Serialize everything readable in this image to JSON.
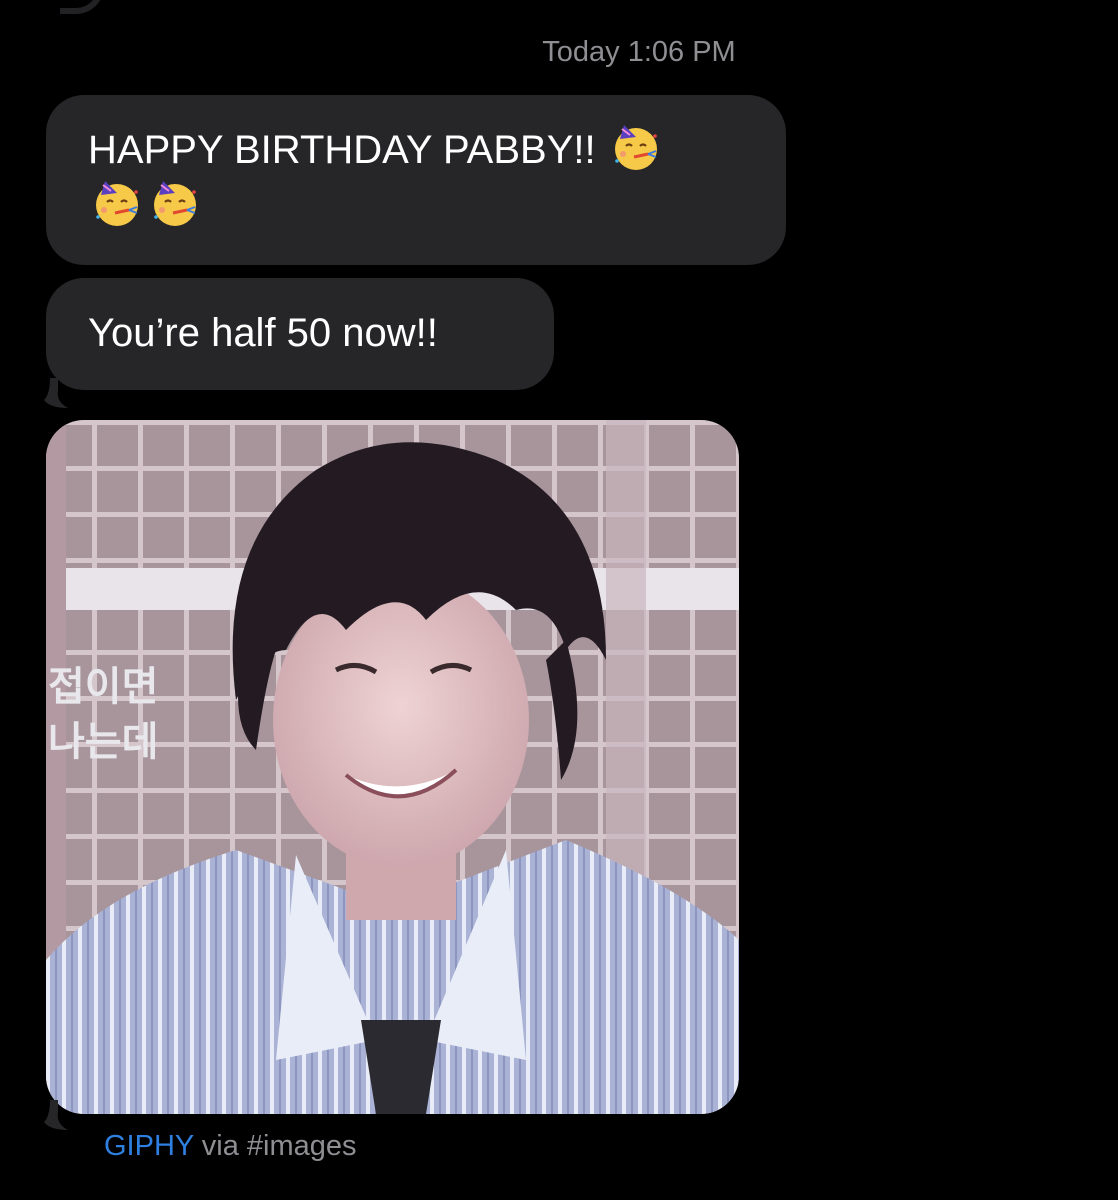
{
  "conversation": {
    "timestamp_day": "Today",
    "timestamp_time": "1:06 PM"
  },
  "messages": [
    {
      "text": "HAPPY BIRTHDAY PABBY!!",
      "emojis": [
        "partying-face-icon",
        "partying-face-icon",
        "partying-face-icon"
      ]
    },
    {
      "text": "You’re half 50 now!!"
    }
  ],
  "gif": {
    "subtitle_line1": "접이면",
    "subtitle_line2": "나는데"
  },
  "attribution": {
    "source": "GIPHY",
    "via": "via #images"
  },
  "colors": {
    "background": "#000000",
    "bubble": "#262628",
    "meta_text": "#8e8e93",
    "link": "#2f7fe0"
  }
}
